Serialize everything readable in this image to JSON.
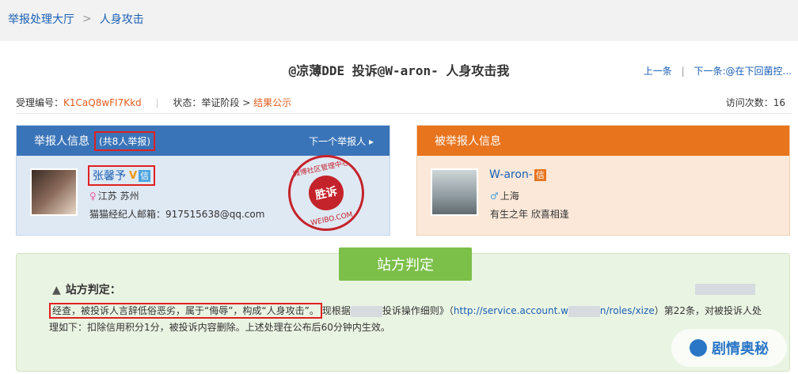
{
  "breadcrumb": {
    "home": "举报处理大厅",
    "sep": ">",
    "current": "人身攻击"
  },
  "title": "@凉薄DDE 投诉@W-aron- 人身攻击我",
  "nav": {
    "prev": "上一条",
    "bar": "|",
    "next": "下一条:@在下回菌控..."
  },
  "meta": {
    "case_label": "受理编号：",
    "case_code": "K1CaQ8wFI7Kkd",
    "status_label": "状态：举证阶段 > ",
    "status_result": "结果公示",
    "visits_label": "访问次数：",
    "visits_count": "16"
  },
  "reporter": {
    "header": "举报人信息",
    "count": "(共8人举报)",
    "next": "下一个举报人 ▸",
    "name": "张馨予",
    "v_badge": "V",
    "xin_badge": "信",
    "gender_symbol": "♀",
    "location": "江苏 苏州",
    "email": "猫猫经纪人邮箱：917515638@qq.com"
  },
  "stamp": {
    "ring_top": "微博社区管理中心",
    "center": "胜诉",
    "ring_bottom": "WEIBO.COM"
  },
  "accused": {
    "header": "被举报人信息",
    "name": "W-aron-",
    "xin_badge": "信",
    "gender_symbol": "♂",
    "location": "上海",
    "bio": "有生之年 欣喜相逢"
  },
  "verdict": {
    "tab": "站方判定",
    "label": "站方判定：",
    "highlighted": "经查，被投诉人言辞低俗恶劣，属于“侮辱”，构成“人身攻击”。",
    "text_1": "现根据",
    "text_2": "投诉操作细则》（",
    "url_1": "http://service.account.w",
    "url_2": "n/roles/xize",
    "text_3": "）第22条，对被投诉人处理如下：扣除信用积分1分，被投诉内容删除。上述处理在公布后60分钟内生效。"
  },
  "watermark": "剧情奥秘"
}
